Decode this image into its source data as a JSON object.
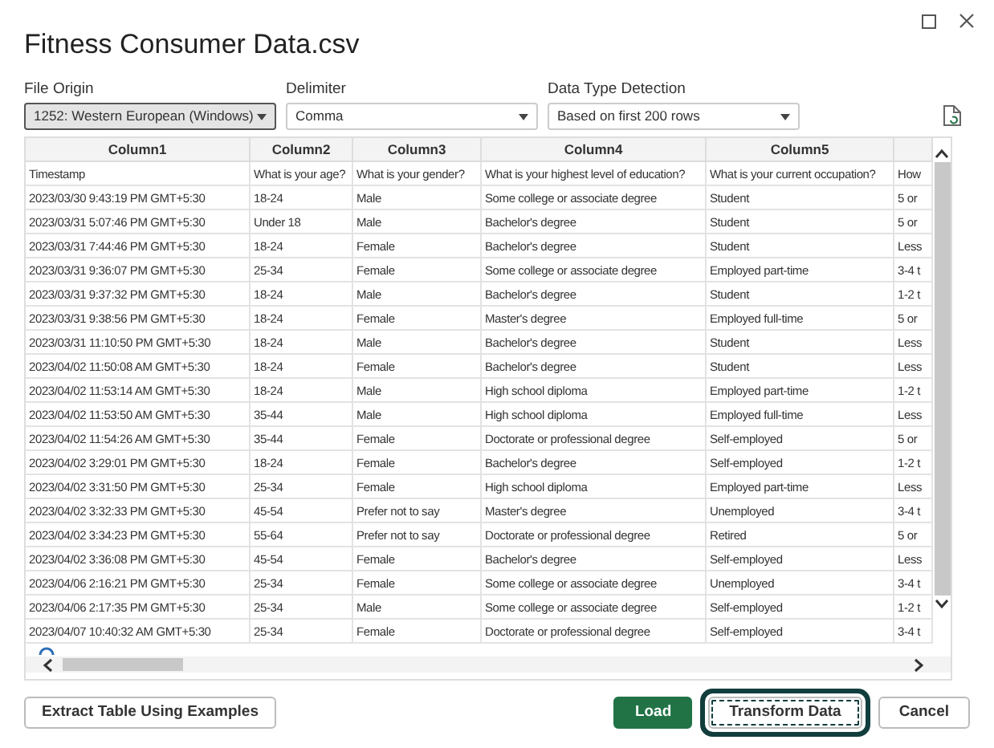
{
  "window": {
    "title": "Fitness Consumer Data.csv"
  },
  "options": [
    {
      "label": "File Origin",
      "value": "1252: Western European (Windows)",
      "focused": true
    },
    {
      "label": "Delimiter",
      "value": "Comma",
      "focused": false
    },
    {
      "label": "Data Type Detection",
      "value": "Based on first 200 rows",
      "focused": false
    }
  ],
  "table": {
    "columns": [
      "Column1",
      "Column2",
      "Column3",
      "Column4",
      "Column5",
      ""
    ],
    "rows": [
      [
        "Timestamp",
        "What is your age?",
        "What is your gender?",
        "What is your highest level of education?",
        "What is your current occupation?",
        "How"
      ],
      [
        "2023/03/30 9:43:19 PM GMT+5:30",
        "18-24",
        "Male",
        "Some college or associate degree",
        "Student",
        "5 or"
      ],
      [
        "2023/03/31 5:07:46 PM GMT+5:30",
        "Under 18",
        "Male",
        "Bachelor's degree",
        "Student",
        "5 or"
      ],
      [
        "2023/03/31 7:44:46 PM GMT+5:30",
        "18-24",
        "Female",
        "Bachelor's degree",
        "Student",
        "Less"
      ],
      [
        "2023/03/31 9:36:07 PM GMT+5:30",
        "25-34",
        "Female",
        "Some college or associate degree",
        "Employed part-time",
        "3-4 t"
      ],
      [
        "2023/03/31 9:37:32 PM GMT+5:30",
        "18-24",
        "Male",
        "Bachelor's degree",
        "Student",
        "1-2 t"
      ],
      [
        "2023/03/31 9:38:56 PM GMT+5:30",
        "18-24",
        "Female",
        "Master's degree",
        "Employed full-time",
        "5 or"
      ],
      [
        "2023/03/31 11:10:50 PM GMT+5:30",
        "18-24",
        "Male",
        "Bachelor's degree",
        "Student",
        "Less"
      ],
      [
        "2023/04/02 11:50:08 AM GMT+5:30",
        "18-24",
        "Female",
        "Bachelor's degree",
        "Student",
        "Less"
      ],
      [
        "2023/04/02 11:53:14 AM GMT+5:30",
        "18-24",
        "Male",
        "High school diploma",
        "Employed part-time",
        "1-2 t"
      ],
      [
        "2023/04/02 11:53:50 AM GMT+5:30",
        "35-44",
        "Male",
        "High school diploma",
        "Employed full-time",
        "Less"
      ],
      [
        "2023/04/02 11:54:26 AM GMT+5:30",
        "35-44",
        "Female",
        "Doctorate or professional degree",
        "Self-employed",
        "5 or"
      ],
      [
        "2023/04/02 3:29:01 PM GMT+5:30",
        "18-24",
        "Female",
        "Bachelor's degree",
        "Self-employed",
        "1-2 t"
      ],
      [
        "2023/04/02 3:31:50 PM GMT+5:30",
        "25-34",
        "Female",
        "High school diploma",
        "Employed part-time",
        "Less"
      ],
      [
        "2023/04/02 3:32:33 PM GMT+5:30",
        "45-54",
        "Prefer not to say",
        "Master's degree",
        "Unemployed",
        "3-4 t"
      ],
      [
        "2023/04/02 3:34:23 PM GMT+5:30",
        "55-64",
        "Prefer not to say",
        "Doctorate or professional degree",
        "Retired",
        "5 or"
      ],
      [
        "2023/04/02 3:36:08 PM GMT+5:30",
        "45-54",
        "Female",
        "Bachelor's degree",
        "Self-employed",
        "Less"
      ],
      [
        "2023/04/06 2:16:21 PM GMT+5:30",
        "25-34",
        "Female",
        "Some college or associate degree",
        "Unemployed",
        "3-4 t"
      ],
      [
        "2023/04/06 2:17:35 PM GMT+5:30",
        "25-34",
        "Male",
        "Some college or associate degree",
        "Self-employed",
        "1-2 t"
      ],
      [
        "2023/04/07 10:40:32 AM GMT+5:30",
        "25-34",
        "Female",
        "Doctorate or professional degree",
        "Self-employed",
        "3-4 t"
      ]
    ]
  },
  "extract_button": "Extract Table Using Examples",
  "buttons": [
    {
      "label": "Load",
      "kind": "primary",
      "focused": false
    },
    {
      "label": "Transform Data",
      "kind": "secondary",
      "focused": true
    },
    {
      "label": "Cancel",
      "kind": "secondary",
      "focused": false
    }
  ]
}
